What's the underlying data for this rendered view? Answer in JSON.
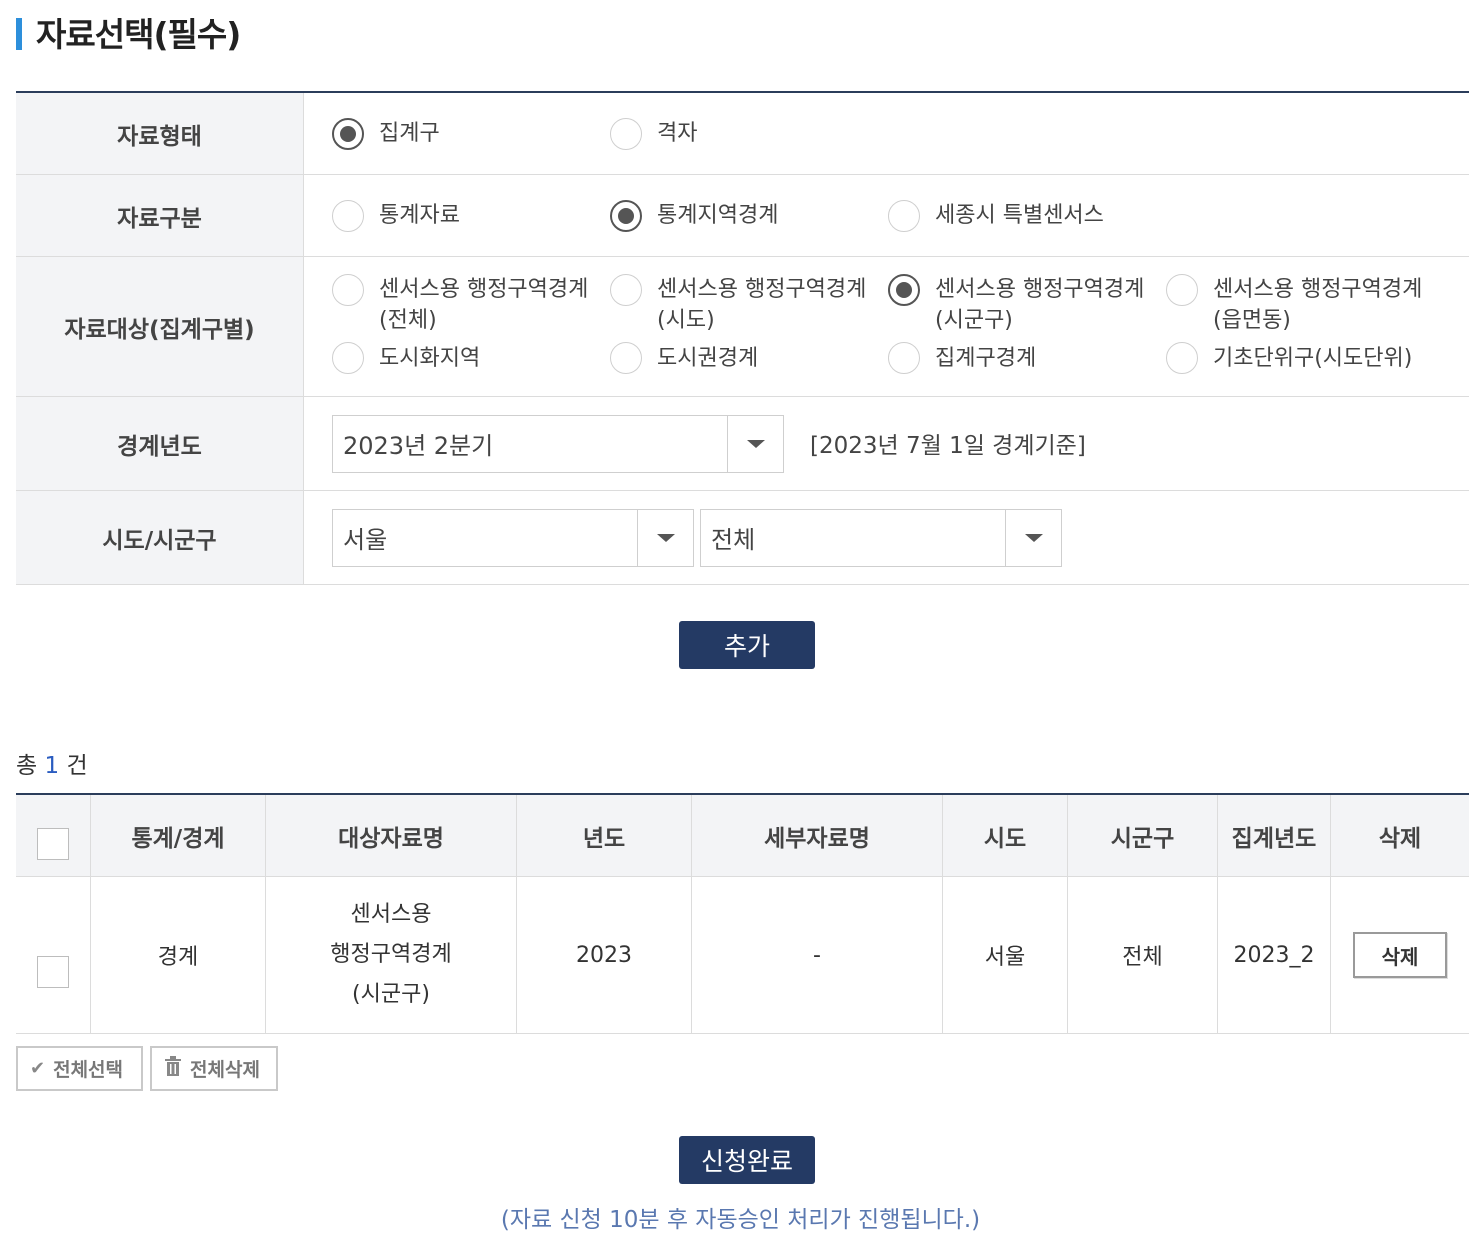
{
  "section": {
    "title": "자료선택(필수)"
  },
  "form": {
    "data_type": {
      "label": "자료형태",
      "options": [
        {
          "text": "집계구",
          "checked": true
        },
        {
          "text": "격자",
          "checked": false
        }
      ]
    },
    "data_category": {
      "label": "자료구분",
      "options": [
        {
          "text": "통계자료",
          "checked": false
        },
        {
          "text": "통계지역경계",
          "checked": true
        },
        {
          "text": "세종시 특별센서스",
          "checked": false
        }
      ]
    },
    "data_target": {
      "label": "자료대상(집계구별)",
      "options": [
        {
          "text": "센서스용 행정구역경계\n(전체)",
          "checked": false
        },
        {
          "text": "센서스용 행정구역경계\n(시도)",
          "checked": false
        },
        {
          "text": "센서스용 행정구역경계\n(시군구)",
          "checked": true
        },
        {
          "text": "센서스용 행정구역경계\n(읍면동)",
          "checked": false
        },
        {
          "text": "도시화지역",
          "checked": false
        },
        {
          "text": "도시권경계",
          "checked": false
        },
        {
          "text": "집계구경계",
          "checked": false
        },
        {
          "text": "기초단위구(시도단위)",
          "checked": false
        }
      ]
    },
    "boundary_year": {
      "label": "경계년도",
      "selected": "2023년 2분기",
      "note": "[2023년 7월 1일 경계기준]"
    },
    "region": {
      "label": "시도/시군구",
      "sido": "서울",
      "sigungu": "전체"
    },
    "add_button": "추가"
  },
  "count": {
    "prefix": "총",
    "value": "1",
    "suffix": "건"
  },
  "table": {
    "headers": [
      "통계/경계",
      "대상자료명",
      "년도",
      "세부자료명",
      "시도",
      "시군구",
      "집계년도",
      "삭제"
    ],
    "rows": [
      {
        "type": "경계",
        "name": "센서스용\n행정구역경계\n(시군구)",
        "year": "2023",
        "detail": "-",
        "sido": "서울",
        "sigungu": "전체",
        "agg_year": "2023_2",
        "delete": "삭제"
      }
    ]
  },
  "actions": {
    "select_all": "전체선택",
    "delete_all": "전체삭제",
    "submit": "신청완료",
    "notice": "(자료 신청 10분 후 자동승인 처리가 진행됩니다.)"
  },
  "colors": {
    "navy": "#243a64",
    "accent_bar": "#2d8fdb",
    "notice": "#5a78b0"
  }
}
